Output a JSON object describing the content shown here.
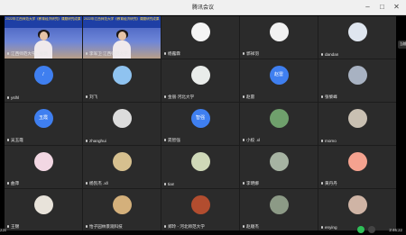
{
  "window": {
    "title": "腾讯会议",
    "min": "–",
    "max": "□",
    "close": "✕"
  },
  "chip": {
    "label": "当前讲者"
  },
  "tiles": [
    {
      "name": "江西师范大学 - 张璐",
      "kind": "video",
      "banner": "2022年江西师范大学《教育经济研究》课题研究成果"
    },
    {
      "name": "李军卫 江西师范大学",
      "kind": "video",
      "banner": "2022年江西师范大学《教育经济研究》课题研究成果"
    },
    {
      "name": "杨露霖",
      "kind": "avatar",
      "color": "#f4f4f4"
    },
    {
      "name": "郭祥羽",
      "kind": "avatar",
      "color": "#f1f1f1"
    },
    {
      "name": "dandan",
      "kind": "avatar",
      "color": "#dfe6ef"
    },
    {
      "name": "yslhl",
      "kind": "text",
      "avatar_text": "/"
    },
    {
      "name": "刘飞",
      "kind": "avatar",
      "color": "#8fc3f0"
    },
    {
      "name": "金丽·河北大学",
      "kind": "avatar",
      "color": "#e9ecea"
    },
    {
      "name": "赵雷",
      "kind": "text",
      "avatar_text": "赵雷"
    },
    {
      "name": "张黎峰",
      "kind": "avatar",
      "color": "#a8b2c2"
    },
    {
      "name": "吴玉霞",
      "kind": "text",
      "avatar_text": "玉霞"
    },
    {
      "name": "zhanghui",
      "kind": "avatar",
      "color": "#dcdcdc"
    },
    {
      "name": "晁智强",
      "kind": "text",
      "avatar_text": "智强"
    },
    {
      "name": "小姣 .xl",
      "kind": "avatar",
      "color": "#6fa06c"
    },
    {
      "name": "momo",
      "kind": "avatar",
      "color": "#c9c0b2"
    },
    {
      "name": "曲萍",
      "kind": "avatar",
      "color": "#f2d7e3"
    },
    {
      "name": "杨凯杰 .xll",
      "kind": "avatar",
      "color": "#d6c08f"
    },
    {
      "name": "tian",
      "kind": "avatar",
      "color": "#cfd8b8"
    },
    {
      "name": "李明娜",
      "kind": "avatar",
      "color": "#a6b3a2"
    },
    {
      "name": "黄丹丹",
      "kind": "avatar",
      "color": "#f4a28f"
    },
    {
      "name": "王锦",
      "kind": "avatar",
      "color": "#e8e3da"
    },
    {
      "name": "怡子园林景观科技",
      "kind": "avatar",
      "color": "#d4b07b"
    },
    {
      "name": "郑玲 - 河北师范大学",
      "kind": "avatar",
      "color": "#b24d2f"
    },
    {
      "name": "赵顺杰",
      "kind": "avatar",
      "color": "#8c9a86"
    },
    {
      "name": "enying",
      "kind": "avatar",
      "color": "#cfb4a5"
    }
  ],
  "bottom": {
    "left_text": "22c",
    "time": "2:46:22"
  },
  "colors": {
    "tile_bg": "#2b2b2b",
    "text_avatar": "#3f7ff0",
    "background": "#1c1c1c"
  }
}
